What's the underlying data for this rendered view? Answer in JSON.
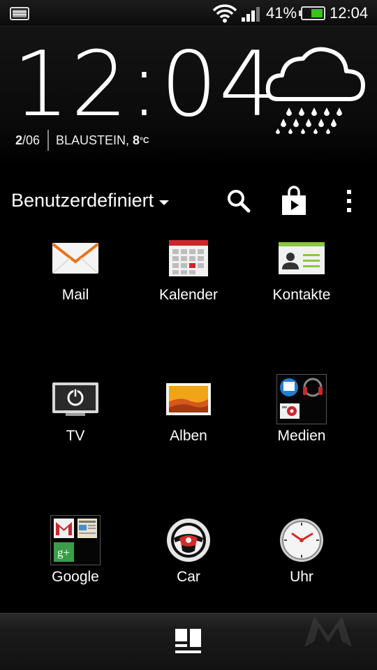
{
  "status_bar": {
    "battery_percent": "41%",
    "time": "12:04",
    "battery_level": 0.41,
    "icons": [
      "notification-icon",
      "wifi-icon",
      "signal-icon",
      "battery-icon"
    ]
  },
  "widget": {
    "clock": "12:04",
    "date_day": "2",
    "date_month": "/06",
    "location": "BLAUSTEIN,",
    "temperature": "8",
    "temp_unit": "°C",
    "weather_icon": "rain-cloud-icon"
  },
  "toolbar": {
    "view_label": "Benutzerdefiniert",
    "icons": [
      "search-icon",
      "store-icon",
      "overflow-menu-icon"
    ]
  },
  "apps": [
    {
      "label": "Mail",
      "icon": "mail-icon"
    },
    {
      "label": "Kalender",
      "icon": "calendar-icon"
    },
    {
      "label": "Kontakte",
      "icon": "contacts-icon"
    },
    {
      "label": "TV",
      "icon": "tv-icon"
    },
    {
      "label": "Alben",
      "icon": "albums-icon"
    },
    {
      "label": "Medien",
      "icon": "media-folder-icon"
    },
    {
      "label": "Google",
      "icon": "google-folder-icon"
    },
    {
      "label": "Car",
      "icon": "car-icon"
    },
    {
      "label": "Uhr",
      "icon": "clock-icon"
    }
  ],
  "colors": {
    "background": "#000000",
    "battery_green": "#39c021",
    "mail_orange": "#e8721c",
    "calendar_red": "#c8282e",
    "contacts_green": "#8cc63f",
    "car_red": "#d32a2a"
  }
}
